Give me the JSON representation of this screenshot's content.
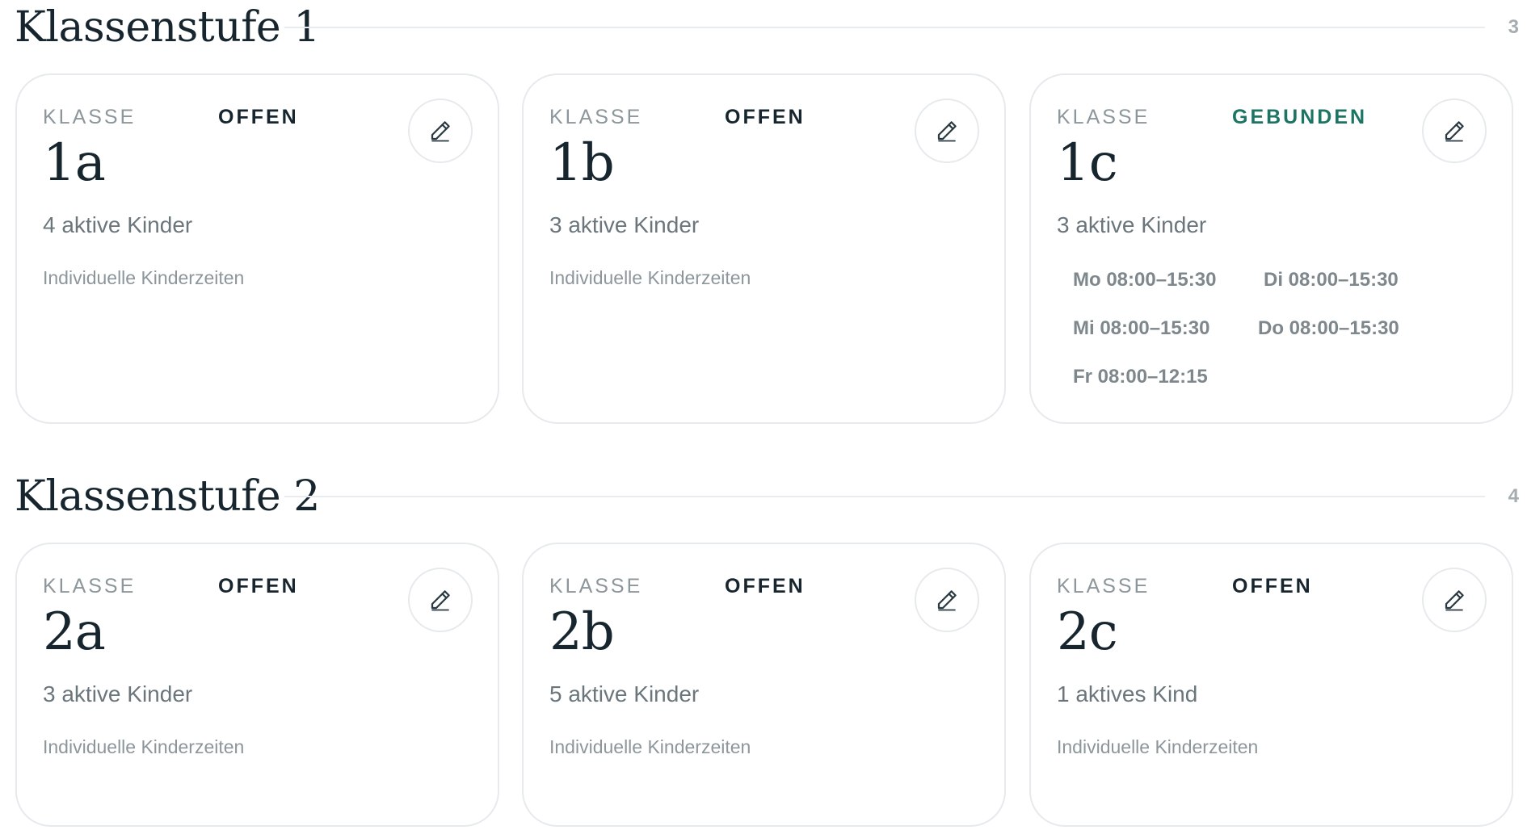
{
  "icons": {
    "edit": "pencil-icon"
  },
  "colors": {
    "text_dark": "#17262e",
    "text_muted": "#8c969b",
    "status_bound": "#1d7465",
    "border": "#e6eaec"
  },
  "sections": [
    {
      "title": "Klassenstufe 1",
      "count": "3",
      "cards": [
        {
          "label": "KLASSE",
          "status": "OFFEN",
          "name": "1a",
          "kids": "4 aktive Kinder",
          "times": "Individuelle Kinderzeiten"
        },
        {
          "label": "KLASSE",
          "status": "OFFEN",
          "name": "1b",
          "kids": "3 aktive Kinder",
          "times": "Individuelle Kinderzeiten"
        },
        {
          "label": "KLASSE",
          "status": "GEBUNDEN",
          "name": "1c",
          "kids": "3 aktive Kinder",
          "schedule": [
            "Mo 08:00–15:30",
            "Di 08:00–15:30",
            "Mi 08:00–15:30",
            "Do 08:00–15:30",
            "Fr 08:00–12:15"
          ]
        }
      ]
    },
    {
      "title": "Klassenstufe 2",
      "count": "4",
      "cards": [
        {
          "label": "KLASSE",
          "status": "OFFEN",
          "name": "2a",
          "kids": "3 aktive Kinder",
          "times": "Individuelle Kinderzeiten"
        },
        {
          "label": "KLASSE",
          "status": "OFFEN",
          "name": "2b",
          "kids": "5 aktive Kinder",
          "times": "Individuelle Kinderzeiten"
        },
        {
          "label": "KLASSE",
          "status": "OFFEN",
          "name": "2c",
          "kids": "1 aktives Kind",
          "times": "Individuelle Kinderzeiten"
        }
      ]
    }
  ]
}
